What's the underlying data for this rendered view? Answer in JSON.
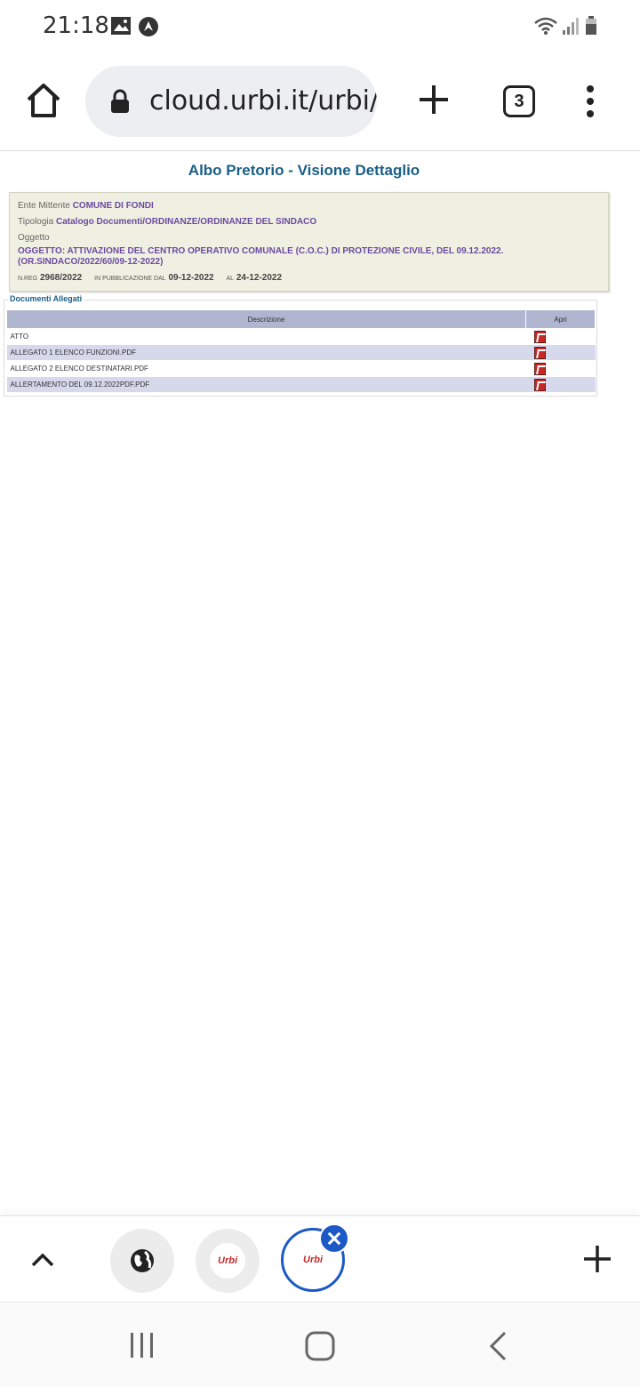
{
  "status": {
    "time": "21:18"
  },
  "browser": {
    "url": "cloud.urbi.it/urbi/",
    "tab_count": "3"
  },
  "page": {
    "title": "Albo Pretorio - Visione Dettaglio",
    "ente_label": "Ente Mittente",
    "ente_value": "COMUNE DI FONDI",
    "tipologia_label": "Tipologia",
    "tipologia_value": "Catalogo Documenti/ORDINANZE/ORDINANZE DEL SINDACO",
    "oggetto_label": "Oggetto",
    "oggetto_value": "OGGETTO: ATTIVAZIONE DEL CENTRO OPERATIVO COMUNALE (C.O.C.) DI PROTEZIONE CIVILE, DEL 09.12.2022. (OR.SINDACO/2022/60/09-12-2022)",
    "nreg_label": "N.REG",
    "nreg_value": "2968/2022",
    "pub_label": "IN PUBBLICAZIONE DAL",
    "pub_from": "09-12-2022",
    "al_label": "AL",
    "pub_to": "24-12-2022"
  },
  "documents": {
    "legend": "Documenti Allegati",
    "col_desc": "Descrizione",
    "col_open": "Apri",
    "rows": [
      {
        "desc": "ATTO"
      },
      {
        "desc": "ALLEGATO 1 ELENCO FUNZIONI.PDF"
      },
      {
        "desc": "ALLEGATO 2 ELENCO DESTINATARI.PDF"
      },
      {
        "desc": "ALLERTAMENTO DEL 09.12.2022PDF.PDF"
      }
    ]
  },
  "tabs": {
    "urbi_logo_text": "Urbi"
  },
  "icons": {
    "status": [
      "gallery-icon",
      "app-notification-icon",
      "wifi-icon",
      "signal-icon",
      "battery-icon"
    ],
    "toolbar": [
      "home-icon",
      "lock-icon",
      "plus-icon",
      "tabs-count-icon",
      "more-vert-icon"
    ],
    "tabbar": [
      "chevron-up-icon",
      "globe-icon",
      "close-icon",
      "plus-icon"
    ],
    "nav": [
      "recent-apps-icon",
      "home-circle-icon",
      "back-icon"
    ]
  },
  "colors": {
    "title_blue": "#1a5f85",
    "value_purple": "#6b4aa0",
    "info_bg": "#eff0e2",
    "table_header": "#b0b5d0",
    "table_alt": "#d6d8ec",
    "active_tab": "#1c59c7"
  }
}
